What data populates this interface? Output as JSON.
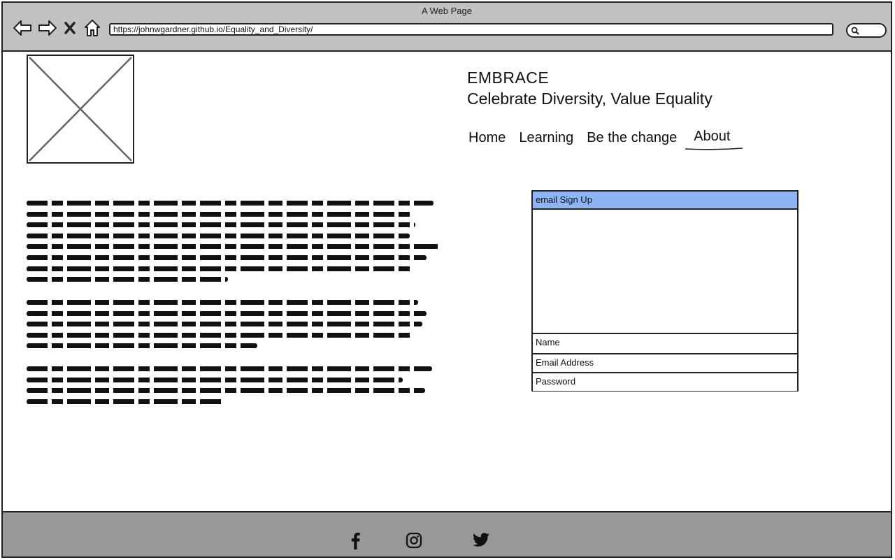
{
  "window": {
    "title": "A Web Page"
  },
  "browser": {
    "url": "https://johnwgardner.github.io/Equality_and_Diversity/"
  },
  "header": {
    "brand": "EMBRACE",
    "tagline": "Celebrate Diversity, Value Equality"
  },
  "nav": {
    "items": [
      {
        "label": "Home"
      },
      {
        "label": "Learning"
      },
      {
        "label": "Be the change"
      },
      {
        "label": "About"
      }
    ]
  },
  "signup": {
    "title": "email Sign Up",
    "fields": [
      "Name",
      "Email Address",
      "Password"
    ]
  },
  "footer": {
    "social_icons": [
      "facebook-icon",
      "instagram-icon",
      "twitter-icon"
    ]
  },
  "colors": {
    "chrome": "#c2c2c2",
    "signup_header": "#8fb4f3",
    "footer": "#999999"
  }
}
